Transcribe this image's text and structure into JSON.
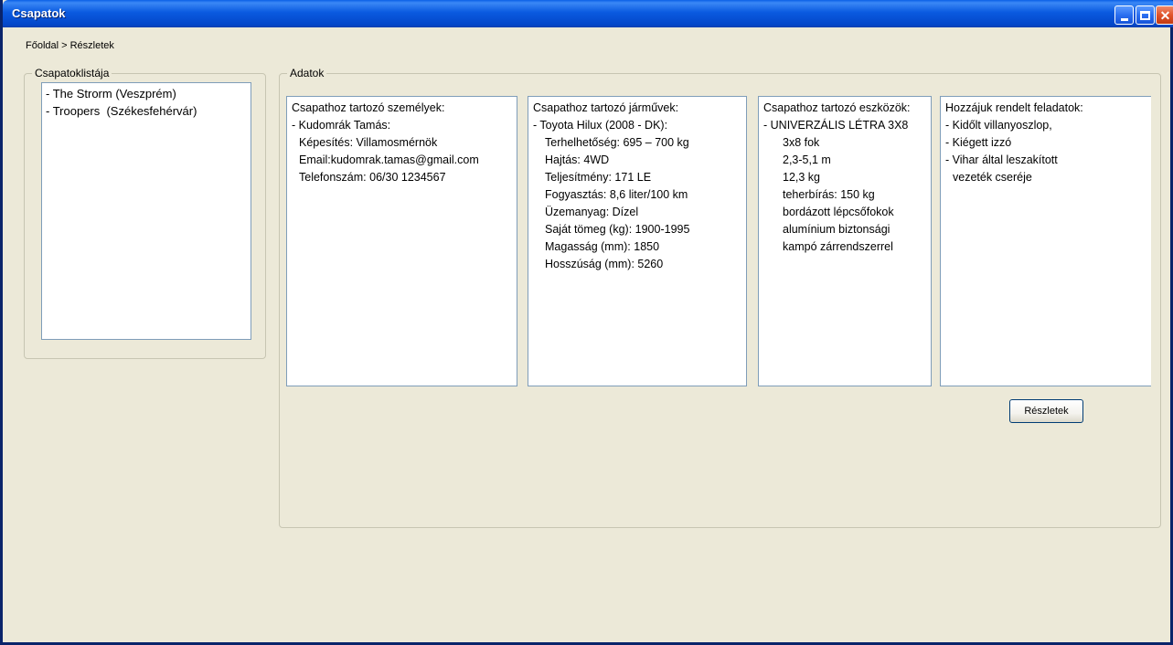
{
  "window": {
    "title": "Csapatok"
  },
  "breadcrumb": "Főoldal > Részletek",
  "teams_group": {
    "legend": "Csapatoklistája",
    "items": [
      "- The Strorm (Veszprém)",
      "- Troopers  (Székesfehérvár)"
    ]
  },
  "data_group": {
    "legend": "Adatok",
    "people": {
      "heading": "Csapathoz tartozó személyek:",
      "name": "- Kudomrák Tamás:",
      "qualification": "Képesítés: Villamosmérnök",
      "email": "Email:kudomrak.tamas@gmail.com",
      "phone": "Telefonszám: 06/30 1234567"
    },
    "vehicles": {
      "heading": "Csapathoz tartozó járművek:",
      "name": "- Toyota Hilux (2008 - DK):",
      "specs": [
        "Terhelhetőség: 695 – 700 kg",
        "Hajtás: 4WD",
        "Teljesítmény: 171 LE",
        "Fogyasztás: 8,6 liter/100 km",
        "Üzemanyag: Dízel",
        "Saját tömeg (kg): 1900-1995",
        "Magasság (mm): 1850",
        "Hosszúság (mm): 5260"
      ]
    },
    "tools": {
      "heading": "Csapathoz tartozó eszközök:",
      "name": "- UNIVERZÁLIS LÉTRA 3X8",
      "specs": [
        "3x8 fok",
        "2,3-5,1 m",
        "12,3 kg",
        "teherbírás: 150 kg",
        "bordázott lépcsőfokok",
        "alumínium biztonsági",
        "kampó zárrendszerrel"
      ]
    },
    "tasks": {
      "heading": "Hozzájuk rendelt feladatok:",
      "items": [
        "- Kidőlt villanyoszlop,",
        "- Kiégett izzó",
        "- Vihar által leszakított"
      ],
      "continuation": "vezeték cseréje"
    }
  },
  "details_button": "Részletek"
}
